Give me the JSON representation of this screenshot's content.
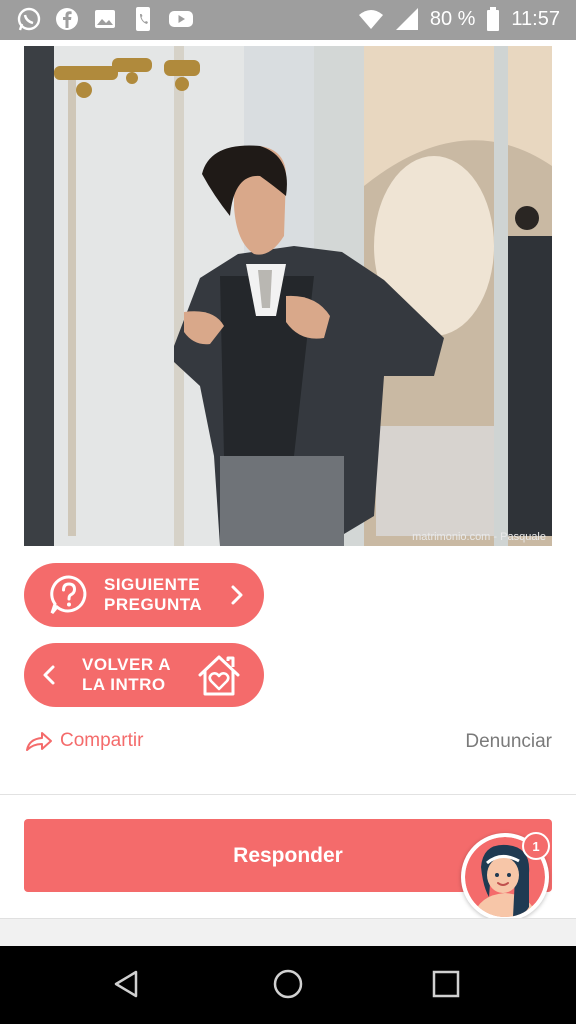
{
  "status_bar": {
    "battery": "80 %",
    "time": "11:57",
    "icons": [
      "whatsapp-icon",
      "facebook-icon",
      "gallery-icon",
      "phone-icon",
      "youtube-icon",
      "wifi-icon",
      "signal-icon",
      "battery-icon"
    ]
  },
  "photo": {
    "credit": "matrimonio.com - Pasquale"
  },
  "buttons": {
    "next_question": "SIGUIENTE\nPREGUNTA",
    "back_intro": "VOLVER A\nLA INTRO"
  },
  "actions": {
    "share": "Compartir",
    "report": "Denunciar"
  },
  "reply": {
    "label": "Responder"
  },
  "chat_badge": {
    "count": "1"
  },
  "colors": {
    "accent": "#f46b6b",
    "status_bar": "#9e9e9e",
    "nav_bar": "#000000"
  }
}
